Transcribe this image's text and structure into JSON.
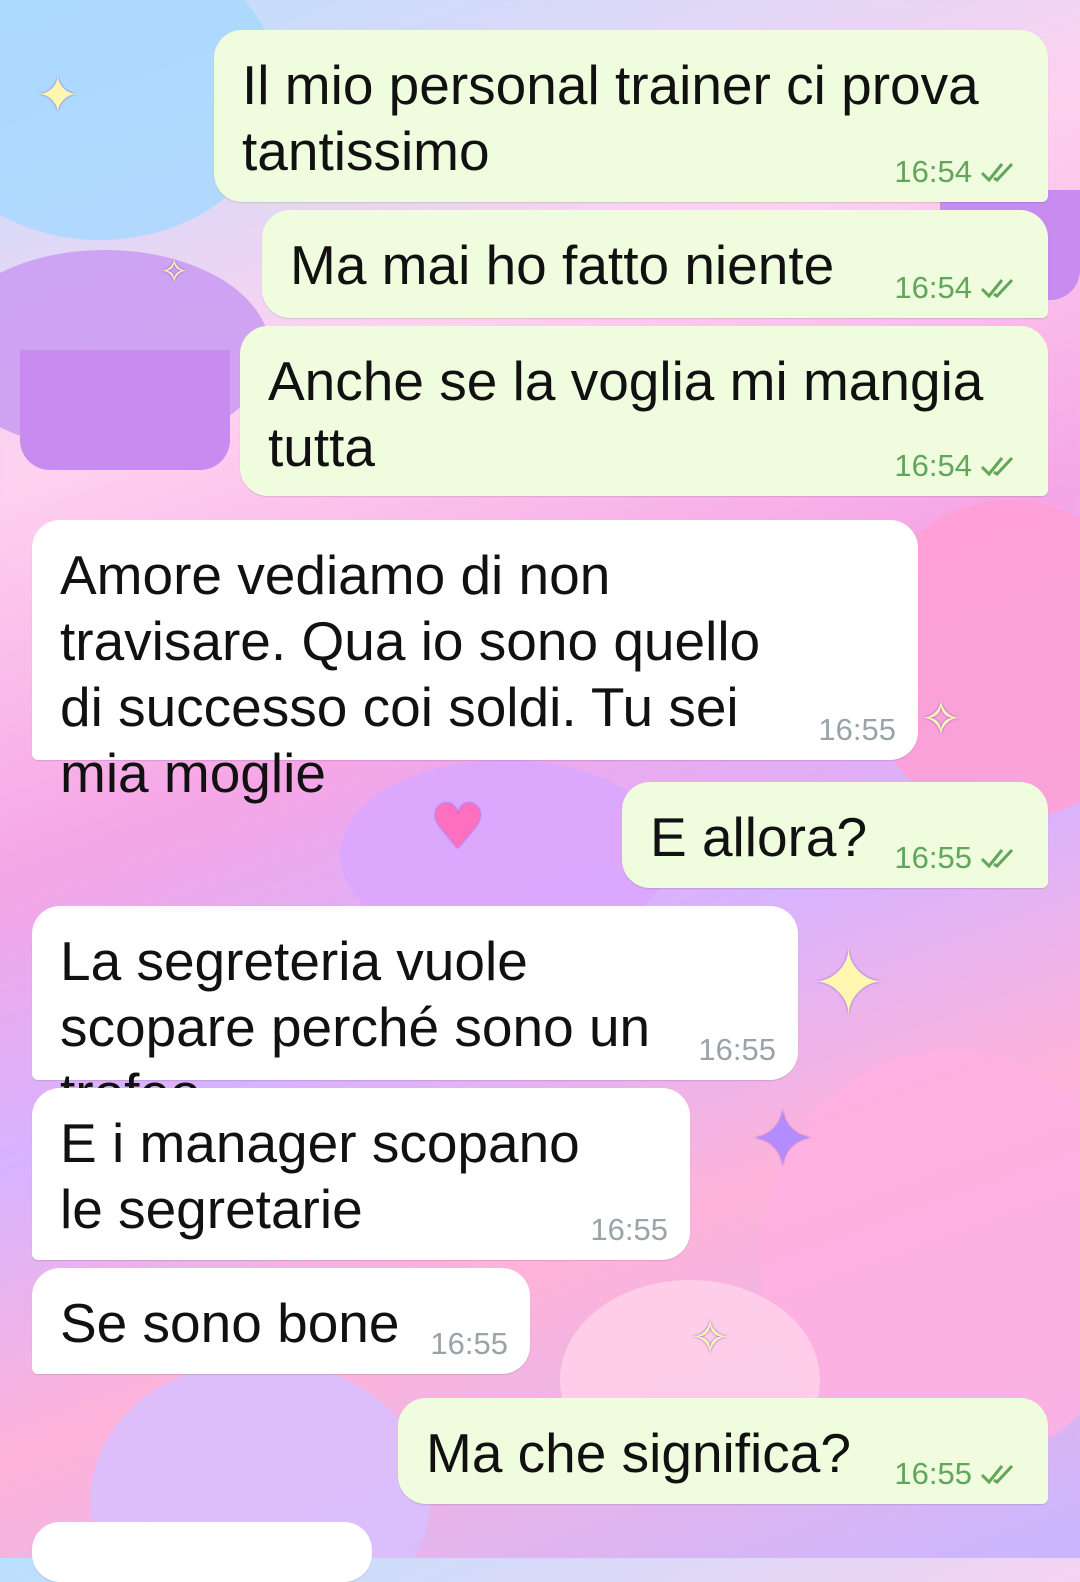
{
  "theme": {
    "outgoing_bubble": "#effdde",
    "incoming_bubble": "#ffffff",
    "outgoing_time_color": "#61a65a",
    "incoming_time_color": "#9aa3a8",
    "read_ticks_color": "#61a65a"
  },
  "messages": [
    {
      "direction": "out",
      "text": "Il mio personal trainer ci prova tantissimo",
      "time": "16:54",
      "status": "read-double-check-icon"
    },
    {
      "direction": "out",
      "text": "Ma mai ho fatto niente",
      "time": "16:54",
      "status": "read-double-check-icon"
    },
    {
      "direction": "out",
      "text": "Anche se la voglia mi mangia tutta",
      "time": "16:54",
      "status": "read-double-check-icon"
    },
    {
      "direction": "in",
      "text": "Amore vediamo di non travisare. Qua io sono quello di successo coi soldi. Tu sei mia moglie",
      "time": "16:55"
    },
    {
      "direction": "out",
      "text": "E allora?",
      "time": "16:55",
      "status": "read-double-check-icon"
    },
    {
      "direction": "in",
      "text": "La segreteria vuole scopare perché sono un trofeo",
      "time": "16:55"
    },
    {
      "direction": "in",
      "text": "E i manager scopano le segretarie",
      "time": "16:55"
    },
    {
      "direction": "in",
      "text": "Se sono bone",
      "time": "16:55"
    },
    {
      "direction": "out",
      "text": "Ma che significa?",
      "time": "16:55",
      "status": "read-double-check-icon"
    }
  ]
}
